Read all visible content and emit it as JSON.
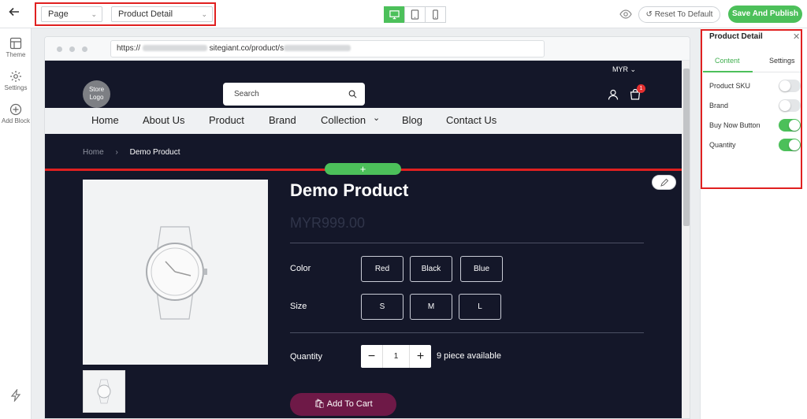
{
  "topbar": {
    "page_select": "Page",
    "template_select": "Product Detail",
    "reset_label": "Reset To Default",
    "publish_label": "Save And Publish",
    "colors": {
      "accent": "#4cc05a",
      "highlight": "#e02020"
    }
  },
  "sidebar": {
    "items": [
      {
        "label": "Theme",
        "icon": "layout-icon"
      },
      {
        "label": "Settings",
        "icon": "gear-icon"
      },
      {
        "label": "Add Block",
        "icon": "plus-circle-icon"
      }
    ]
  },
  "browser": {
    "url_prefix": "https://",
    "url_domain": "sitegiant.co/product/s"
  },
  "store": {
    "currency": "MYR",
    "logo_line1": "Store",
    "logo_line2": "Logo",
    "search_placeholder": "Search",
    "cart_count": "1",
    "nav": [
      "Home",
      "About Us",
      "Product",
      "Brand",
      "Collection",
      "Blog",
      "Contact Us"
    ],
    "breadcrumb": {
      "home": "Home",
      "current": "Demo Product"
    }
  },
  "product": {
    "title": "Demo Product",
    "price": "MYR999.00",
    "color_label": "Color",
    "colors": [
      "Red",
      "Black",
      "Blue"
    ],
    "size_label": "Size",
    "sizes": [
      "S",
      "M",
      "L"
    ],
    "quantity_label": "Quantity",
    "quantity": "1",
    "available": "9 piece available",
    "add_to_cart": "Add To Cart",
    "theme_colors": {
      "background": "#141729",
      "cart_button": "#6e1947"
    }
  },
  "panel": {
    "title": "Product Detail",
    "tabs": [
      "Content",
      "Settings"
    ],
    "rows": [
      {
        "label": "Product SKU",
        "on": false
      },
      {
        "label": "Brand",
        "on": false
      },
      {
        "label": "Buy Now Button",
        "on": true
      },
      {
        "label": "Quantity",
        "on": true
      }
    ]
  }
}
